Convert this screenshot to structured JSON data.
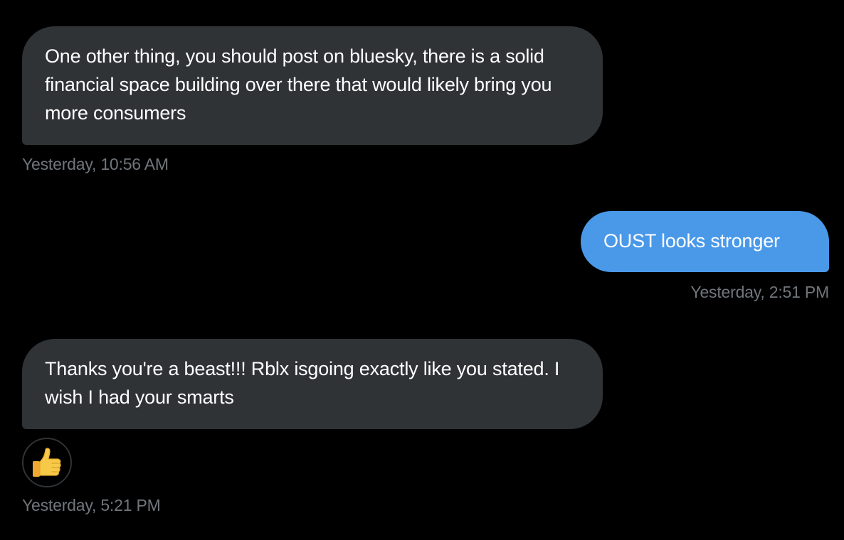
{
  "messages": [
    {
      "direction": "incoming",
      "text": "One other thing, you should post on bluesky, there is a solid financial space building over there that would likely bring you more consumers",
      "timestamp": "Yesterday, 10:56 AM"
    },
    {
      "direction": "outgoing",
      "text": "OUST looks stronger",
      "timestamp": "Yesterday, 2:51 PM"
    },
    {
      "direction": "incoming",
      "text": "Thanks you're a beast!!! Rblx isgoing exactly like you stated.  I wish I had your smarts",
      "timestamp": "Yesterday, 5:21 PM",
      "reaction": "thumbs-up-icon"
    }
  ],
  "colors": {
    "background": "#000000",
    "incoming_bubble": "#2f3336",
    "outgoing_bubble": "#4a99e9",
    "timestamp": "#71767b",
    "message_text": "#ffffff"
  }
}
